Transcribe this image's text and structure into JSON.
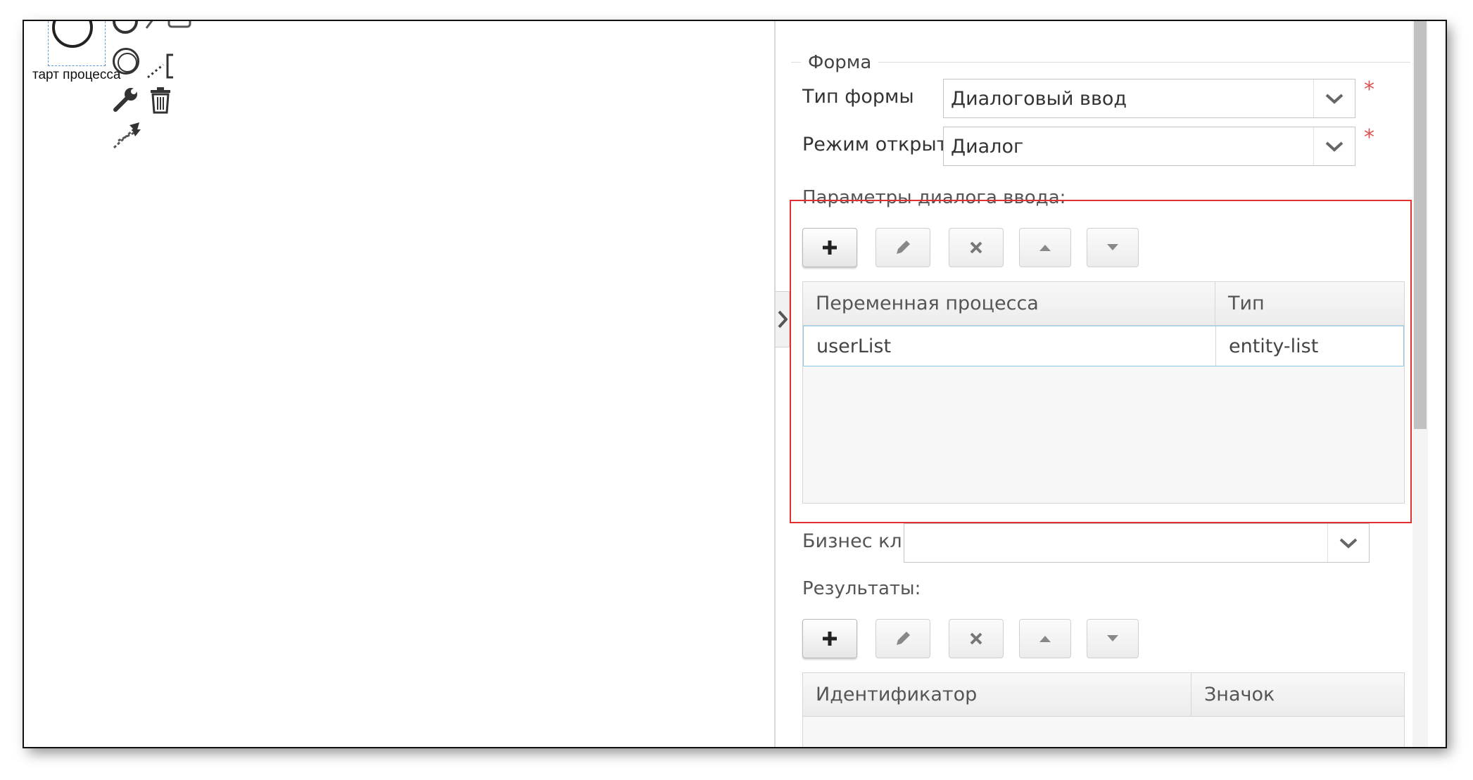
{
  "canvas": {
    "start_event_label": "тарт процесса"
  },
  "panel": {
    "legend": "Форма",
    "form_type": {
      "label": "Тип формы",
      "value": "Диалоговый ввод",
      "required_mark": "*"
    },
    "open_mode": {
      "label": "Режим открытия",
      "value": "Диалог",
      "required_mark": "*"
    },
    "dialog_params": {
      "caption": "Параметры диалога ввода:",
      "columns": [
        "Переменная процесса",
        "Тип"
      ],
      "rows": [
        {
          "variable": "userList",
          "type": "entity-list"
        }
      ]
    },
    "business_key": {
      "label": "Бизнес ключ",
      "value": ""
    },
    "results": {
      "caption": "Результаты:",
      "columns": [
        "Идентификатор",
        "Значок"
      ]
    }
  },
  "colors": {
    "highlight": "#e03030",
    "required": "#d9534f",
    "selected_row_border": "#8ec8e8"
  }
}
